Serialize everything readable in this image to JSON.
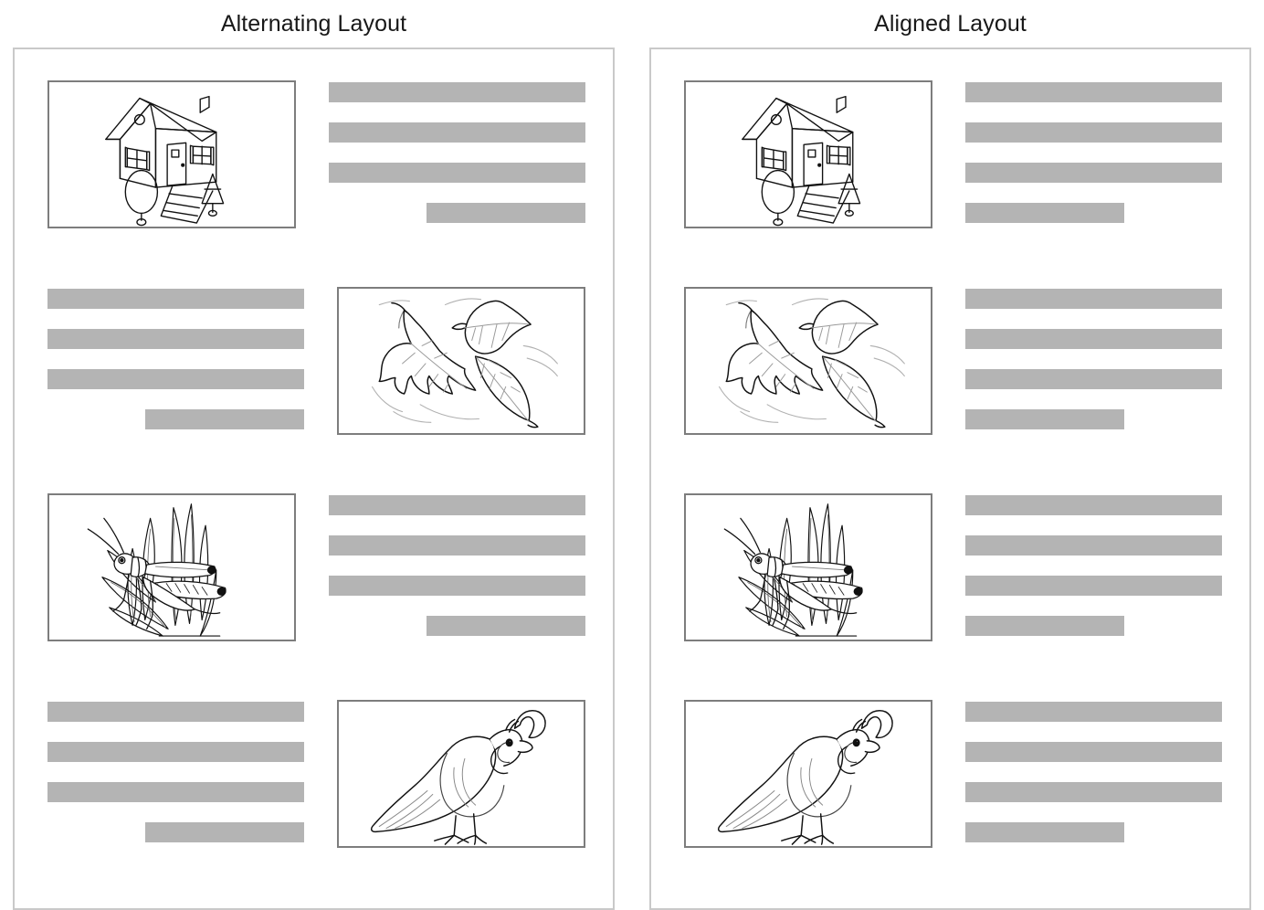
{
  "page": {
    "background_color": "#ffffff",
    "bar_color": "#b4b4b4",
    "panel_border_color": "#c9c9c9",
    "figure_border_color": "#7d7d7d",
    "title_color": "#181818"
  },
  "columns": [
    {
      "title": "Alternating Layout",
      "last_line_alignment": "right",
      "rows": [
        {
          "image": "house-illustration",
          "image_side": "left",
          "lines": 4,
          "short_last_line_width_pct": 62
        },
        {
          "image": "autumn-leaves-illustration",
          "image_side": "right",
          "lines": 4,
          "short_last_line_width_pct": 62
        },
        {
          "image": "grasshopper-illustration",
          "image_side": "left",
          "lines": 4,
          "short_last_line_width_pct": 62
        },
        {
          "image": "quail-bird-illustration",
          "image_side": "right",
          "lines": 4,
          "short_last_line_width_pct": 62
        }
      ]
    },
    {
      "title": "Aligned Layout",
      "last_line_alignment": "left",
      "rows": [
        {
          "image": "house-illustration",
          "image_side": "left",
          "lines": 4,
          "short_last_line_width_pct": 62
        },
        {
          "image": "autumn-leaves-illustration",
          "image_side": "left",
          "lines": 4,
          "short_last_line_width_pct": 62
        },
        {
          "image": "grasshopper-illustration",
          "image_side": "left",
          "lines": 4,
          "short_last_line_width_pct": 62
        },
        {
          "image": "quail-bird-illustration",
          "image_side": "left",
          "lines": 4,
          "short_last_line_width_pct": 62
        }
      ]
    }
  ]
}
